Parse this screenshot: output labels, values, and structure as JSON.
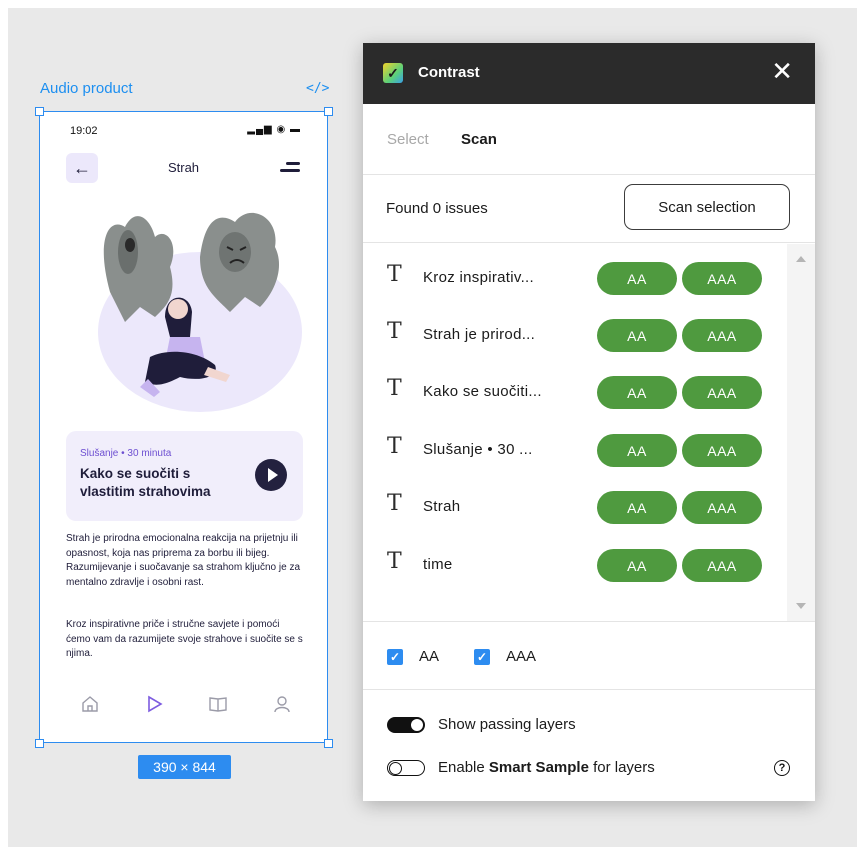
{
  "canvas": {
    "frame_label": "Audio product",
    "size_badge": "390 × 844"
  },
  "phone": {
    "status_time": "19:02",
    "title": "Strah",
    "card": {
      "meta": "Slušanje • 30 minuta",
      "title": "Kako se suočiti s vlastitim strahovima"
    },
    "paragraphs": [
      "Strah je prirodna emocionalna reakcija na prijetnju ili opasnost, koja nas priprema za borbu ili bijeg. Razumijevanje i suočavanje sa strahom ključno je za mentalno zdravlje i osobni rast.",
      "Kroz inspirativne priče i stručne savjete i pomoći ćemo vam da razumijete svoje strahove i suočite se s njima."
    ],
    "tabs": [
      "home-icon",
      "play-icon",
      "book-icon",
      "profile-icon"
    ]
  },
  "plugin": {
    "title": "Contrast",
    "tabs": {
      "select": "Select",
      "scan": "Scan"
    },
    "found_text": "Found 0 issues",
    "scan_button": "Scan selection",
    "issues": [
      {
        "name": "Kroz inspirativ...",
        "aa": "AA",
        "aaa": "AAA"
      },
      {
        "name": "Strah je prirod...",
        "aa": "AA",
        "aaa": "AAA"
      },
      {
        "name": "Kako se suočiti...",
        "aa": "AA",
        "aaa": "AAA"
      },
      {
        "name": "Slušanje • 30 ...",
        "aa": "AA",
        "aaa": "AAA"
      },
      {
        "name": "Strah",
        "aa": "AA",
        "aaa": "AAA"
      },
      {
        "name": "time",
        "aa": "AA",
        "aaa": "AAA"
      }
    ],
    "filters": {
      "aa": "AA",
      "aaa": "AAA"
    },
    "show_passing": "Show passing layers",
    "smart_sample_prefix": "Enable ",
    "smart_sample_bold": "Smart Sample",
    "smart_sample_suffix": " for layers",
    "colors": {
      "pass_green": "#4f9a3f",
      "accent_blue": "#2d8cf0",
      "header_dark": "#2b2b2b"
    }
  }
}
